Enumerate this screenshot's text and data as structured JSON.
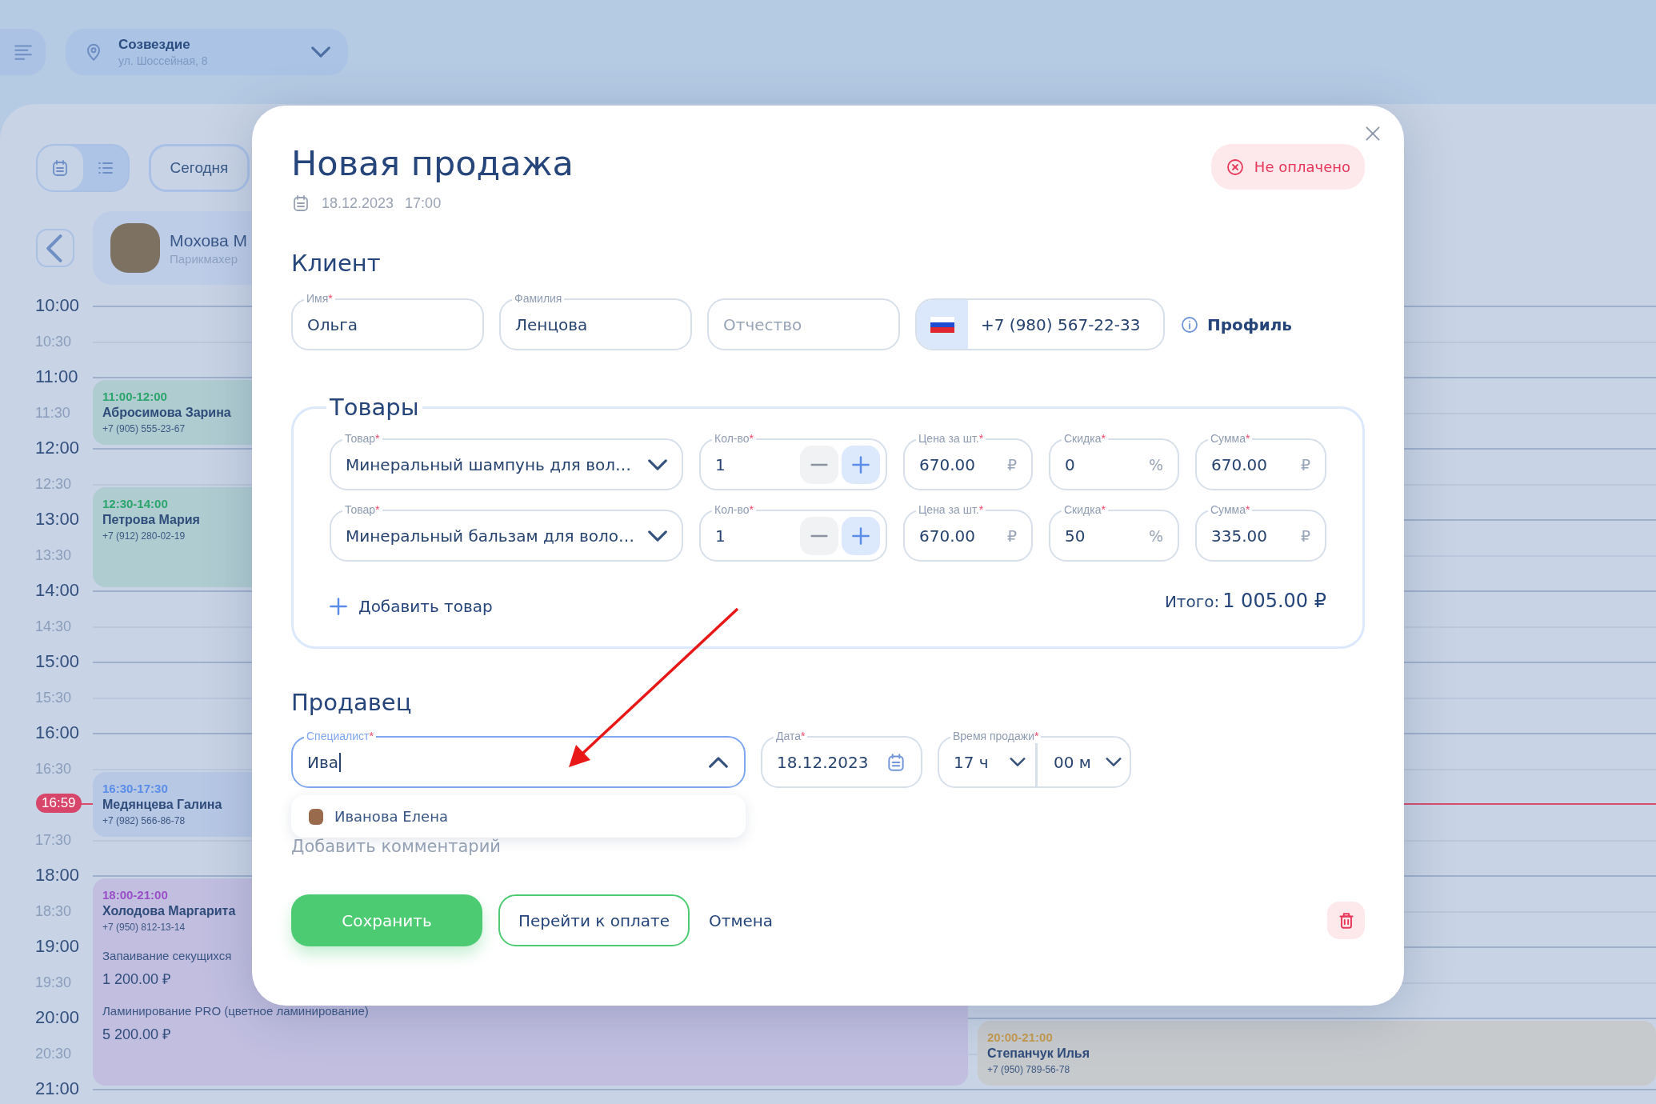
{
  "topbar": {
    "location": {
      "name": "Созвездие",
      "address": "ул. Шоссейная, 8"
    }
  },
  "calendar": {
    "view_modes": [
      {
        "kind": "calendar",
        "selected": true
      },
      {
        "kind": "list",
        "selected": false
      }
    ],
    "today_button": "Сегодня",
    "time_labels": [
      {
        "text": "10:00",
        "kind": "hour"
      },
      {
        "text": "10:30",
        "kind": "half"
      },
      {
        "text": "11:00",
        "kind": "hour"
      },
      {
        "text": "11:30",
        "kind": "half"
      },
      {
        "text": "12:00",
        "kind": "hour"
      },
      {
        "text": "12:30",
        "kind": "half"
      },
      {
        "text": "13:00",
        "kind": "hour"
      },
      {
        "text": "13:30",
        "kind": "half"
      },
      {
        "text": "14:00",
        "kind": "hour"
      },
      {
        "text": "14:30",
        "kind": "half"
      },
      {
        "text": "15:00",
        "kind": "hour"
      },
      {
        "text": "15:30",
        "kind": "half"
      },
      {
        "text": "16:00",
        "kind": "hour"
      },
      {
        "text": "16:30",
        "kind": "half"
      },
      {
        "text": "17:30",
        "kind": "half"
      },
      {
        "text": "18:00",
        "kind": "hour"
      },
      {
        "text": "18:30",
        "kind": "half"
      },
      {
        "text": "19:00",
        "kind": "hour"
      },
      {
        "text": "19:30",
        "kind": "half"
      },
      {
        "text": "20:00",
        "kind": "hour"
      },
      {
        "text": "20:30",
        "kind": "half"
      },
      {
        "text": "21:00",
        "kind": "hour"
      }
    ],
    "now": "16:59",
    "columns": [
      {
        "staff": {
          "name": "Мохова М",
          "role": "Парикмахер"
        },
        "events": [
          {
            "time": "11:00-12:00",
            "name": "Абросимова Зарина",
            "phone": "+7 (905) 555-23-67",
            "color": "#2ba56b"
          },
          {
            "time": "12:30-14:00",
            "name": "Петрова Мария",
            "phone": "+7 (912) 280-02-19",
            "color": "#2ba56b"
          },
          {
            "time": "16:30-17:30",
            "name": "Медянцева Галина",
            "phone": "+7 (982) 566-86-78",
            "color": "#5b8de8"
          },
          {
            "time": "18:00-21:00",
            "name": "Холодова Маргарита",
            "phone": "+7 (950) 812-13-14",
            "color": "#9a4fc8",
            "services": [
              {
                "name": "Запаивание секущихся",
                "price": "1 200.00 ₽"
              },
              {
                "name": "Ламинирование PRO (цветное ламинирование)",
                "price": "5 200.00 ₽"
              }
            ]
          }
        ]
      },
      {
        "events": [
          {
            "time": "20:00-21:00",
            "name": "Степанчук Илья",
            "phone": "+7 (950) 789-56-78",
            "color": "#c49a4c"
          }
        ]
      }
    ]
  },
  "modal": {
    "title": "Новая продажа",
    "date": "18.12.2023",
    "time": "17:00",
    "payment_status": {
      "label": "Не оплачено",
      "paid": false
    },
    "client": {
      "heading": "Клиент",
      "fields": [
        {
          "label": "Имя",
          "mark": "*",
          "value": "Ольга"
        },
        {
          "label": "Фамилия",
          "value": "Ленцова"
        },
        {
          "placeholder": "Отчество"
        }
      ],
      "phone": {
        "value": "+7 (980) 567-22-33"
      },
      "profile_link": "Профиль"
    },
    "goods": {
      "heading": "Товары",
      "rows": [
        {
          "product": {
            "label": "Товар",
            "mark": "*",
            "value": "Минеральный шампунь для вол…"
          },
          "quantity": {
            "label": "Кол-во",
            "mark": "*",
            "value": "1"
          },
          "price": {
            "label": "Цена за шт.",
            "mark": "*",
            "value": "670.00",
            "unit": "₽"
          },
          "discount": {
            "label": "Скидка",
            "mark": "*",
            "value": "0",
            "unit": "%"
          },
          "sum": {
            "label": "Сумма",
            "mark": "*",
            "value": "670.00",
            "unit": "₽"
          }
        },
        {
          "product": {
            "label": "Товар",
            "mark": "*",
            "value": "Минеральный бальзам для воло…"
          },
          "quantity": {
            "label": "Кол-во",
            "mark": "*",
            "value": "1"
          },
          "price": {
            "label": "Цена за шт.",
            "mark": "*",
            "value": "670.00",
            "unit": "₽"
          },
          "discount": {
            "label": "Скидка",
            "mark": "*",
            "value": "50",
            "unit": "%"
          },
          "sum": {
            "label": "Сумма",
            "mark": "*",
            "value": "335.00",
            "unit": "₽"
          }
        }
      ],
      "add_button": "Добавить товар",
      "total_label": "Итого:",
      "total_value": "1 005.00 ₽"
    },
    "seller": {
      "heading": "Продавец",
      "specialist": {
        "label": "Специалист",
        "mark": "*",
        "value": "Ива",
        "focused": true,
        "expanded": true
      },
      "suggestions": [
        {
          "name": "Иванова Елена"
        }
      ],
      "date": {
        "label": "Дата",
        "mark": "*",
        "value": "18.12.2023"
      },
      "sale_time": {
        "label": "Время продажи",
        "mark": "*",
        "hours": "17 ч",
        "minutes": "00 м"
      }
    },
    "comment_link": "Добавить комментарий",
    "actions": [
      {
        "kind": "primary",
        "label": "Сохранить"
      },
      {
        "kind": "outline",
        "label": "Перейти к оплате"
      },
      {
        "kind": "text",
        "label": "Отмена"
      }
    ]
  }
}
